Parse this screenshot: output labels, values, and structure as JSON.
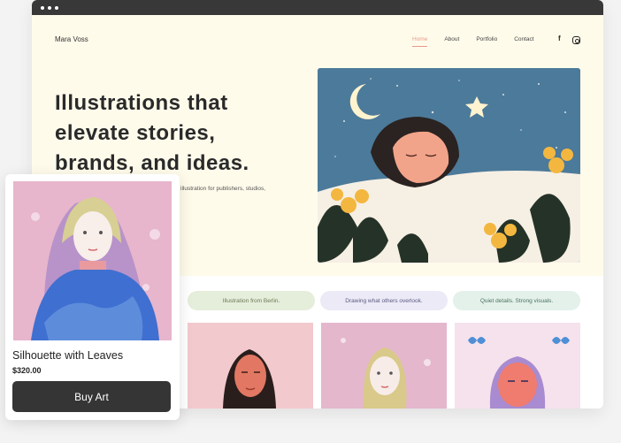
{
  "site": {
    "brand": "Mara Voss",
    "nav": [
      "Home",
      "About",
      "Portfolio",
      "Contact"
    ],
    "active_nav": "Home",
    "social_icons": [
      "facebook-icon",
      "instagram-icon"
    ]
  },
  "hero": {
    "headline_lines": [
      "Illustrations that",
      "elevate stories,",
      "brands, and ideas."
    ],
    "subtext": "illustration for publishers, studios,"
  },
  "pills": [
    "Illustration from Berlin.",
    "Drawing what others overlook.",
    "Quiet details. Strong visuals."
  ],
  "card": {
    "title": "Silhouette with Leaves",
    "price": "$320.00",
    "button": "Buy Art"
  },
  "colors": {
    "browser_bar": "#383838",
    "page_bg": "#fffbeb",
    "accent": "#e59a8a",
    "button": "#353535"
  }
}
